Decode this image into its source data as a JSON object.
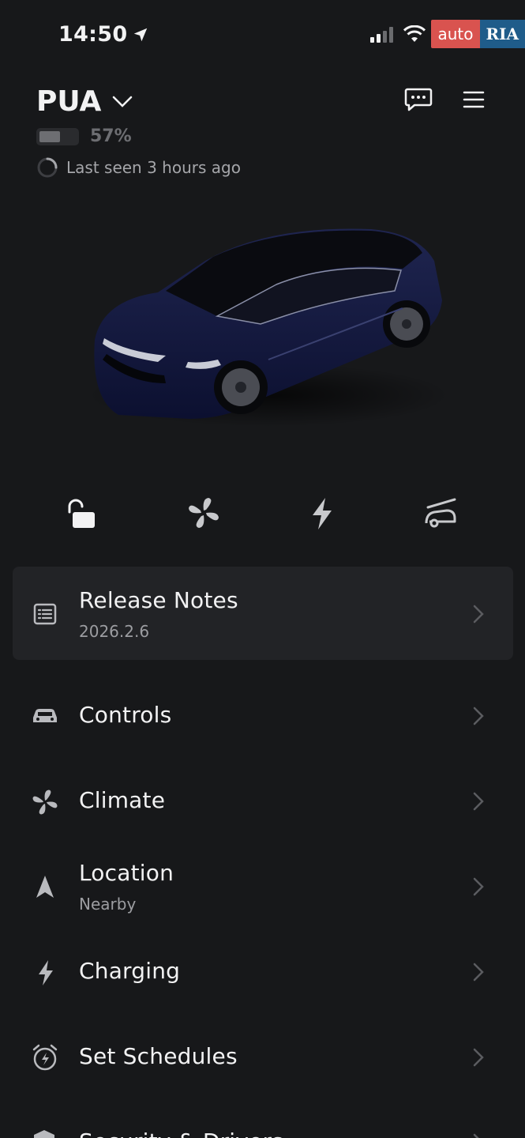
{
  "status_bar": {
    "time": "14:50",
    "watermark_auto": "auto",
    "watermark_ria": "RIA"
  },
  "header": {
    "vehicle_name": "PUA",
    "battery_percent": "57%",
    "battery_level": 0.57,
    "last_seen": "Last seen 3 hours ago"
  },
  "quick_actions": [
    {
      "icon": "unlock-icon"
    },
    {
      "icon": "fan-icon"
    },
    {
      "icon": "bolt-icon"
    },
    {
      "icon": "charge-port-icon"
    }
  ],
  "menu": {
    "release_notes": {
      "title": "Release Notes",
      "subtitle": "2026.2.6",
      "icon": "list-icon"
    },
    "controls": {
      "title": "Controls",
      "icon": "car-icon"
    },
    "climate": {
      "title": "Climate",
      "icon": "fan-icon"
    },
    "location": {
      "title": "Location",
      "subtitle": "Nearby",
      "icon": "navigation-arrow-icon"
    },
    "charging": {
      "title": "Charging",
      "icon": "bolt-icon"
    },
    "schedules": {
      "title": "Set Schedules",
      "icon": "alarm-clock-icon"
    },
    "security": {
      "title": "Security & Drivers",
      "icon": "shield-icon"
    }
  },
  "colors": {
    "background": "#17181a",
    "card": "#222326",
    "text": "#f2f2f3",
    "muted": "#9c9da1",
    "car_body": "#14193a"
  }
}
